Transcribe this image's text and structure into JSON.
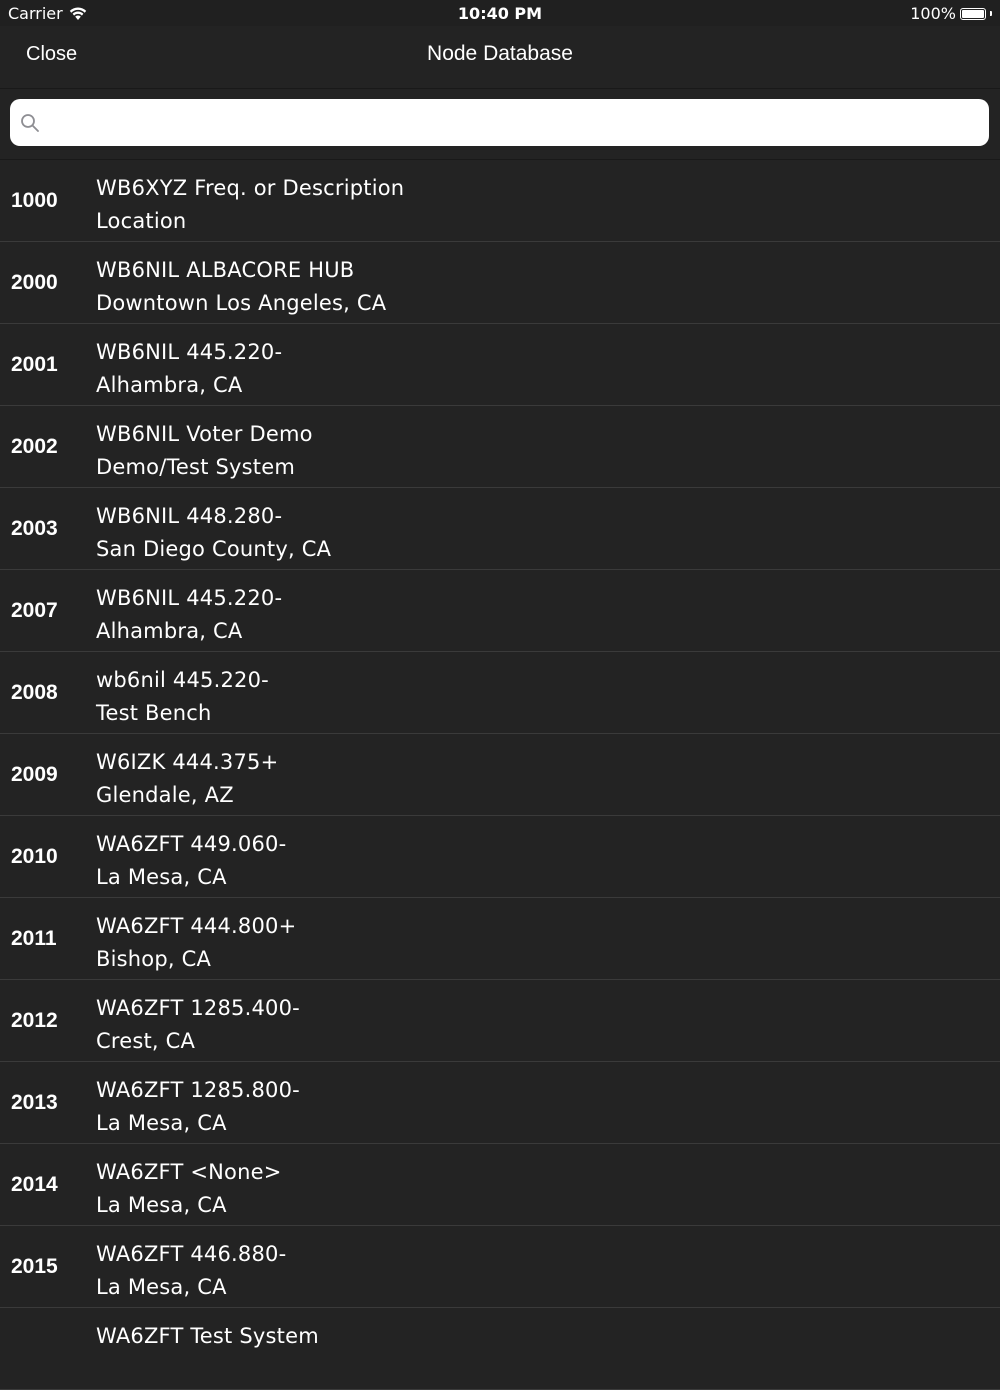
{
  "status_bar": {
    "carrier": "Carrier",
    "time": "10:40 PM",
    "battery": "100%",
    "battery_level": 1.0
  },
  "nav_bar": {
    "close_label": "Close",
    "title": "Node Database"
  },
  "search": {
    "value": "",
    "placeholder": ""
  },
  "nodes": [
    {
      "number": "1000",
      "line1": "WB6XYZ Freq. or Description",
      "line2": "Location"
    },
    {
      "number": "2000",
      "line1": "WB6NIL ALBACORE HUB",
      "line2": "Downtown Los Angeles, CA"
    },
    {
      "number": "2001",
      "line1": "WB6NIL 445.220-",
      "line2": "Alhambra, CA"
    },
    {
      "number": "2002",
      "line1": "WB6NIL Voter Demo",
      "line2": "Demo/Test System"
    },
    {
      "number": "2003",
      "line1": "WB6NIL 448.280-",
      "line2": "San Diego County, CA"
    },
    {
      "number": "2007",
      "line1": "WB6NIL 445.220-",
      "line2": "Alhambra, CA"
    },
    {
      "number": "2008",
      "line1": "wb6nil 445.220-",
      "line2": "Test Bench"
    },
    {
      "number": "2009",
      "line1": "W6IZK 444.375+",
      "line2": "Glendale, AZ"
    },
    {
      "number": "2010",
      "line1": "WA6ZFT 449.060-",
      "line2": "La Mesa, CA"
    },
    {
      "number": "2011",
      "line1": "WA6ZFT 444.800+",
      "line2": "Bishop, CA"
    },
    {
      "number": "2012",
      "line1": "WA6ZFT 1285.400-",
      "line2": "Crest, CA"
    },
    {
      "number": "2013",
      "line1": "WA6ZFT 1285.800-",
      "line2": "La Mesa, CA"
    },
    {
      "number": "2014",
      "line1": "WA6ZFT <None>",
      "line2": "La Mesa, CA"
    },
    {
      "number": "2015",
      "line1": "WA6ZFT 446.880-",
      "line2": "La Mesa, CA"
    },
    {
      "number": "",
      "line1": "WA6ZFT Test System",
      "line2": ""
    }
  ]
}
